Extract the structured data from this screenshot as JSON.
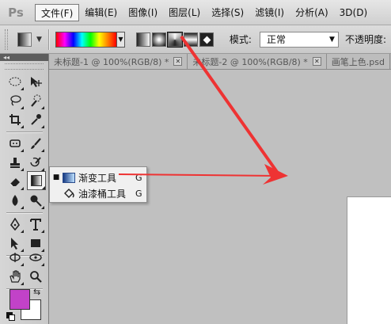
{
  "menubar": {
    "logo": "Ps",
    "items": [
      {
        "label": "文件(F)"
      },
      {
        "label": "编辑(E)"
      },
      {
        "label": "图像(I)"
      },
      {
        "label": "图层(L)"
      },
      {
        "label": "选择(S)"
      },
      {
        "label": "滤镜(I)"
      },
      {
        "label": "分析(A)"
      },
      {
        "label": "3D(D)"
      }
    ]
  },
  "options": {
    "mode_label": "模式:",
    "mode_value": "正常",
    "opacity_label": "不透明度:",
    "gradient_types": [
      "linear",
      "radial",
      "angle",
      "reflected",
      "diamond"
    ],
    "selected_gradient_type": "angle"
  },
  "tabs": [
    {
      "label": "未标题-1 @ 100%(RGB/8) *",
      "close": "✕"
    },
    {
      "label": "未标题-2 @ 100%(RGB/8) *",
      "close": "✕"
    },
    {
      "label": "画笔上色.psd",
      "close": ""
    }
  ],
  "toolbox": {
    "collapse": "◂◂",
    "foreground_color": "#c242c8",
    "background_color": "#ffffff"
  },
  "flyout": {
    "items": [
      {
        "bullet": "■",
        "label": "渐变工具",
        "shortcut": "G",
        "icon": "gradient-icon"
      },
      {
        "bullet": "",
        "label": "油漆桶工具",
        "shortcut": "G",
        "icon": "paint-bucket-icon"
      }
    ]
  },
  "annotation": {
    "color": "#ee3333"
  }
}
